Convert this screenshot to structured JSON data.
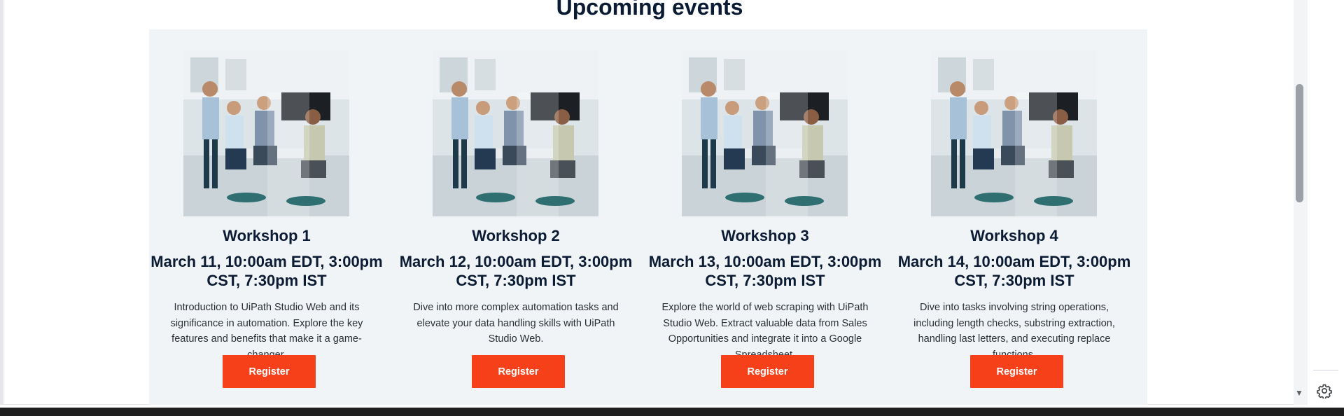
{
  "section": {
    "title": "Upcoming events"
  },
  "events": [
    {
      "title": "Workshop 1",
      "date": "March 11, 10:00am EDT, 3:00pm CST, 7:30pm IST",
      "description": "Introduction to UiPath Studio Web and its significance in automation. Explore the key features and benefits that make it a game-changer.",
      "register_label": "Register"
    },
    {
      "title": "Workshop 2",
      "date": "March 12, 10:00am EDT, 3:00pm CST, 7:30pm IST",
      "description": "Dive into more complex automation tasks and elevate your data handling skills with UiPath Studio Web.",
      "register_label": "Register"
    },
    {
      "title": "Workshop 3",
      "date": "March 13, 10:00am EDT, 3:00pm CST, 7:30pm IST",
      "description": "Explore the world of web scraping with UiPath Studio Web. Extract valuable data from Sales Opportunities and integrate it into a Google Spreadsheet.",
      "register_label": "Register"
    },
    {
      "title": "Workshop 4",
      "date": "March 14, 10:00am EDT, 3:00pm CST, 7:30pm IST",
      "description": "Dive into tasks involving string operations, including length checks, substring extraction, handling last letters, and executing replace functions.",
      "register_label": "Register"
    }
  ],
  "colors": {
    "accent": "#f5401a",
    "panel_background": "#f0f4f6",
    "heading": "#0b1b33"
  },
  "icons": {
    "settings": "gear-icon",
    "scroll_down": "triangle-down-icon",
    "event_image": "office-meeting-photo"
  }
}
